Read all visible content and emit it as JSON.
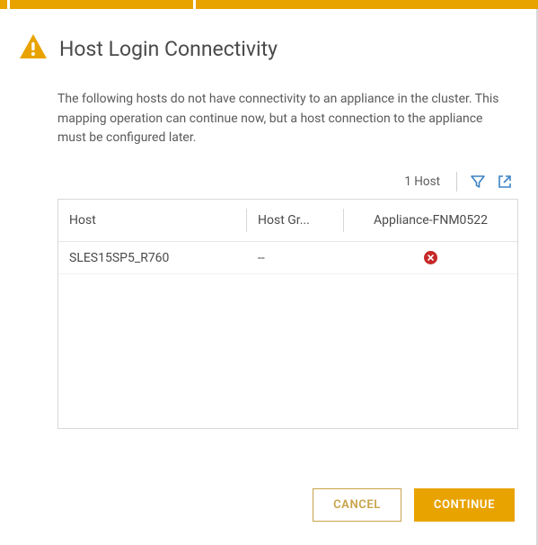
{
  "header": {
    "title": "Host Login Connectivity"
  },
  "description": "The following hosts do not have connectivity to an appliance in the cluster. This mapping operation can continue now, but a host connection to the appliance must be configured later.",
  "toolbar": {
    "host_count": "1 Host"
  },
  "table": {
    "columns": {
      "host": "Host",
      "host_group": "Host Gr...",
      "appliance": "Appliance-FNM0522"
    },
    "rows": [
      {
        "host": "SLES15SP5_R760",
        "host_group": "--",
        "status": "error"
      }
    ]
  },
  "footer": {
    "cancel": "CANCEL",
    "continue": "CONTINUE"
  }
}
